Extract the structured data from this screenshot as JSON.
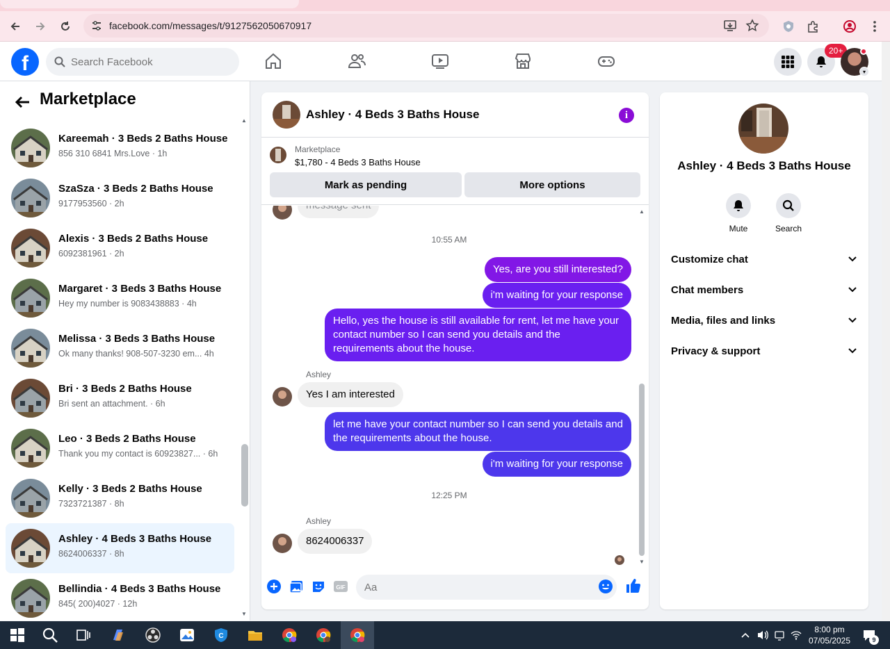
{
  "browser": {
    "url": "facebook.com/messages/t/9127562050670917"
  },
  "fb": {
    "search_placeholder": "Search Facebook",
    "notifications_badge": "20+"
  },
  "left": {
    "title": "Marketplace",
    "conversations": [
      {
        "name": "Kareemah · 3 Beds 2 Baths House",
        "snippet": "856 310 6841 Mrs.Love · 1h"
      },
      {
        "name": "SzaSza · 3 Beds 2 Baths House",
        "snippet": "9177953560 · 2h"
      },
      {
        "name": "Alexis · 3 Beds 2 Baths House",
        "snippet": "6092381961 · 2h"
      },
      {
        "name": "Margaret · 3 Beds 3 Baths House",
        "snippet": "Hey my number is 9083438883 · 4h"
      },
      {
        "name": "Melissa · 3 Beds 3 Baths House",
        "snippet": "Ok many thanks! 908-507-3230 em...   4h"
      },
      {
        "name": "Bri · 3 Beds 2 Baths House",
        "snippet": "Bri sent an attachment. · 6h"
      },
      {
        "name": "Leo · 3 Beds 2 Baths House",
        "snippet": "Thank you my contact is 60923827...  · 6h"
      },
      {
        "name": "Kelly · 3 Beds 2 Baths House",
        "snippet": "7323721387 · 8h"
      },
      {
        "name": "Ashley · 4 Beds 3 Baths House",
        "snippet": "8624006337 · 8h"
      },
      {
        "name": "Bellindia · 4 Beds 3 Baths House",
        "snippet": "845( 200)4027 · 12h"
      }
    ]
  },
  "chat": {
    "title": "Ashley · 4 Beds 3 Baths House",
    "listing_category": "Marketplace",
    "listing_price": "$1,780 - 4 Beds 3 Baths House",
    "mark_pending": "Mark as pending",
    "more_options": "More options",
    "partial_message": "message sent",
    "time1": "10:55 AM",
    "out1": "Yes, are you still interested?",
    "out2": "i'm waiting for your response",
    "out3": "Hello, yes the house is still available for rent, let me have your contact number so I can send you details and the requirements about the house.",
    "sender1": "Ashley",
    "in1": "Yes I am interested",
    "out4": "let me have your contact number so I can send you details and the requirements about the house.",
    "out5": "i'm waiting for your response",
    "time2": "12:25 PM",
    "sender2": "Ashley",
    "in2": "8624006337",
    "composer_placeholder": "Aa"
  },
  "details": {
    "title": "Ashley · 4 Beds 3 Baths House",
    "mute": "Mute",
    "search": "Search",
    "rows": [
      "Customize chat",
      "Chat members",
      "Media, files and links",
      "Privacy & support"
    ]
  },
  "taskbar": {
    "time": "8:00 pm",
    "date": "07/05/2025",
    "notifications": "9"
  },
  "colors": {
    "fb_blue": "#0866ff",
    "outgoing_purple": "#8217e6",
    "outgoing_blue": "#4d37ec",
    "info_purple": "#8a0cd6"
  }
}
